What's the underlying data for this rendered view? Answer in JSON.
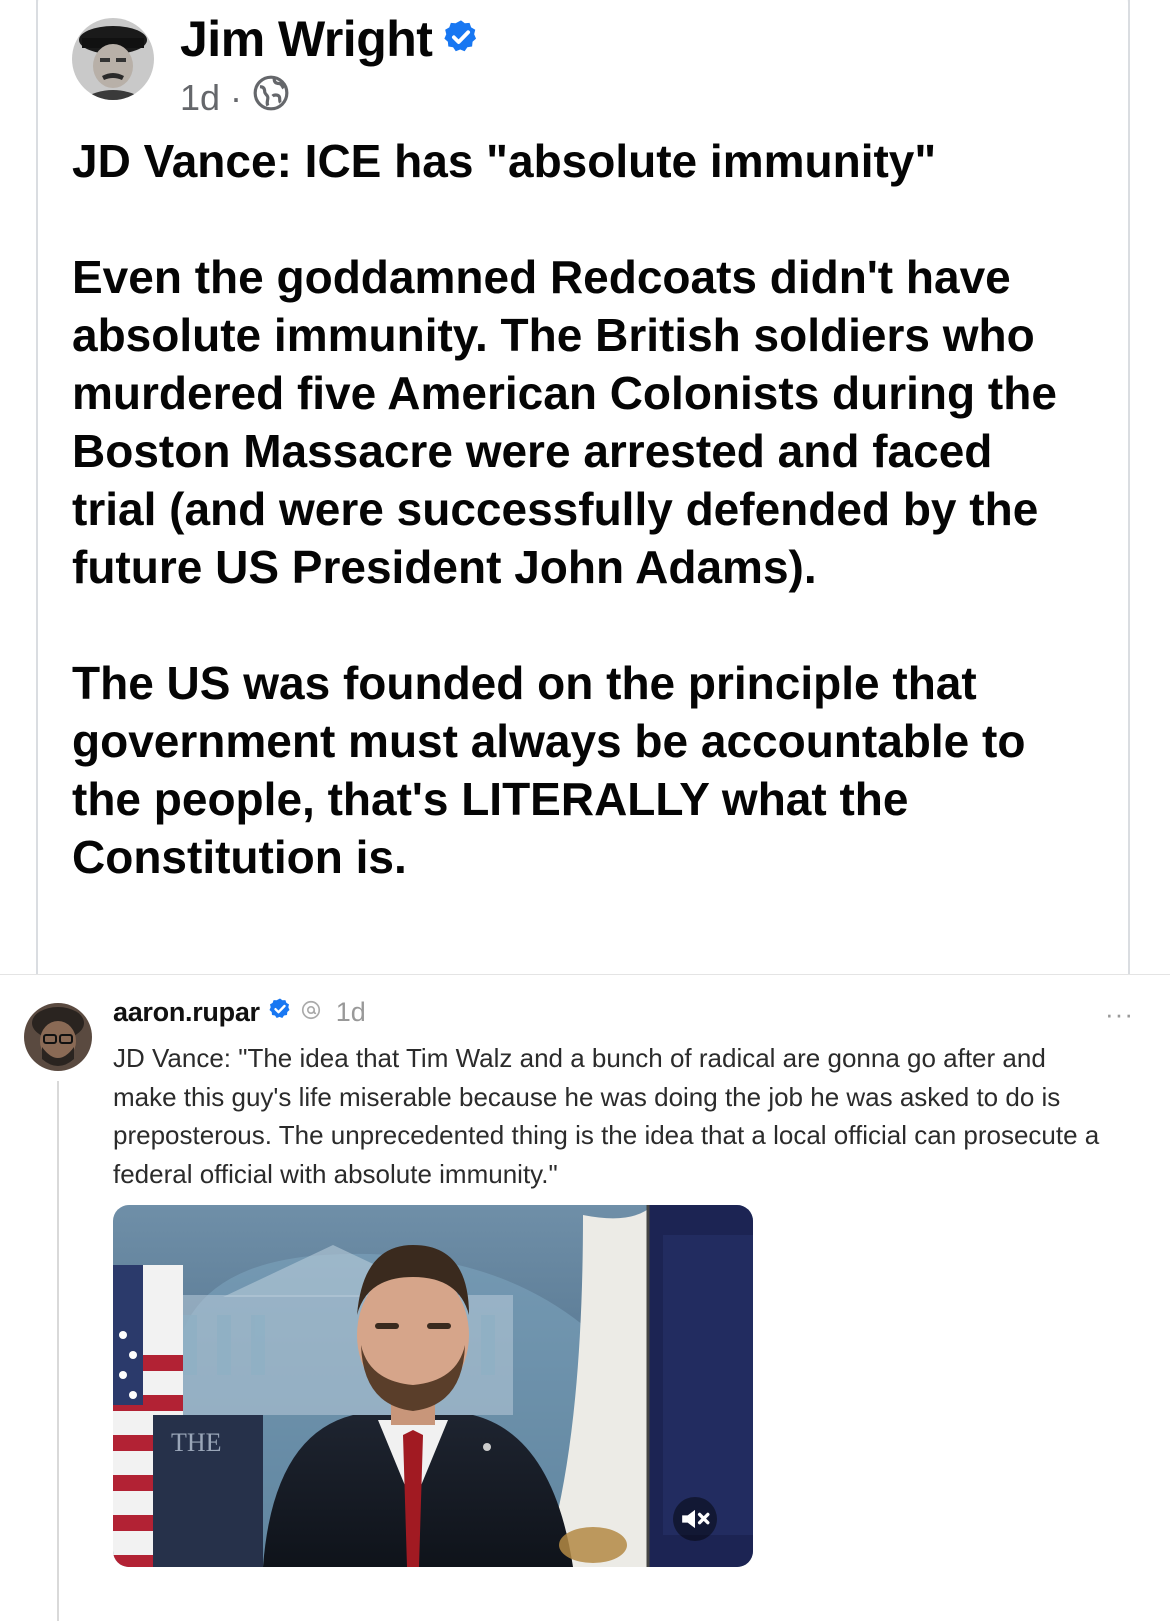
{
  "post": {
    "author": "Jim Wright",
    "time": "1d",
    "separator": "·",
    "privacy_icon": "globe-icon",
    "verified_icon": "verified-badge-icon",
    "headline": "JD Vance: ICE has \"absolute immunity\"",
    "paragraph_1": "Even the goddamned Redcoats didn't have absolute immunity. The British soldiers who murdered five American Colonists during the Boston Massacre were arrested and faced trial (and were successfully defended by the future US President John Adams).",
    "paragraph_2": "The US was founded on the principle that government must always be accountable to the people, that's LITERALLY what the Constitution is."
  },
  "embedded": {
    "username": "aaron.rupar",
    "time": "1d",
    "more": "···",
    "text": "JD Vance: \"The idea that Tim Walz and a bunch of radical are gonna go after and make this guy's life miserable because he was doing the job he was asked to do is preposterous. The unprecedented thing is the idea that a local official can prosecute a federal official with absolute immunity.\"",
    "video_sign_text": "THE",
    "mute_icon": "muted-speaker-icon"
  },
  "colors": {
    "verified_blue": "#1877f2",
    "meta_gray": "#65676b",
    "card_border": "#dadde1"
  }
}
